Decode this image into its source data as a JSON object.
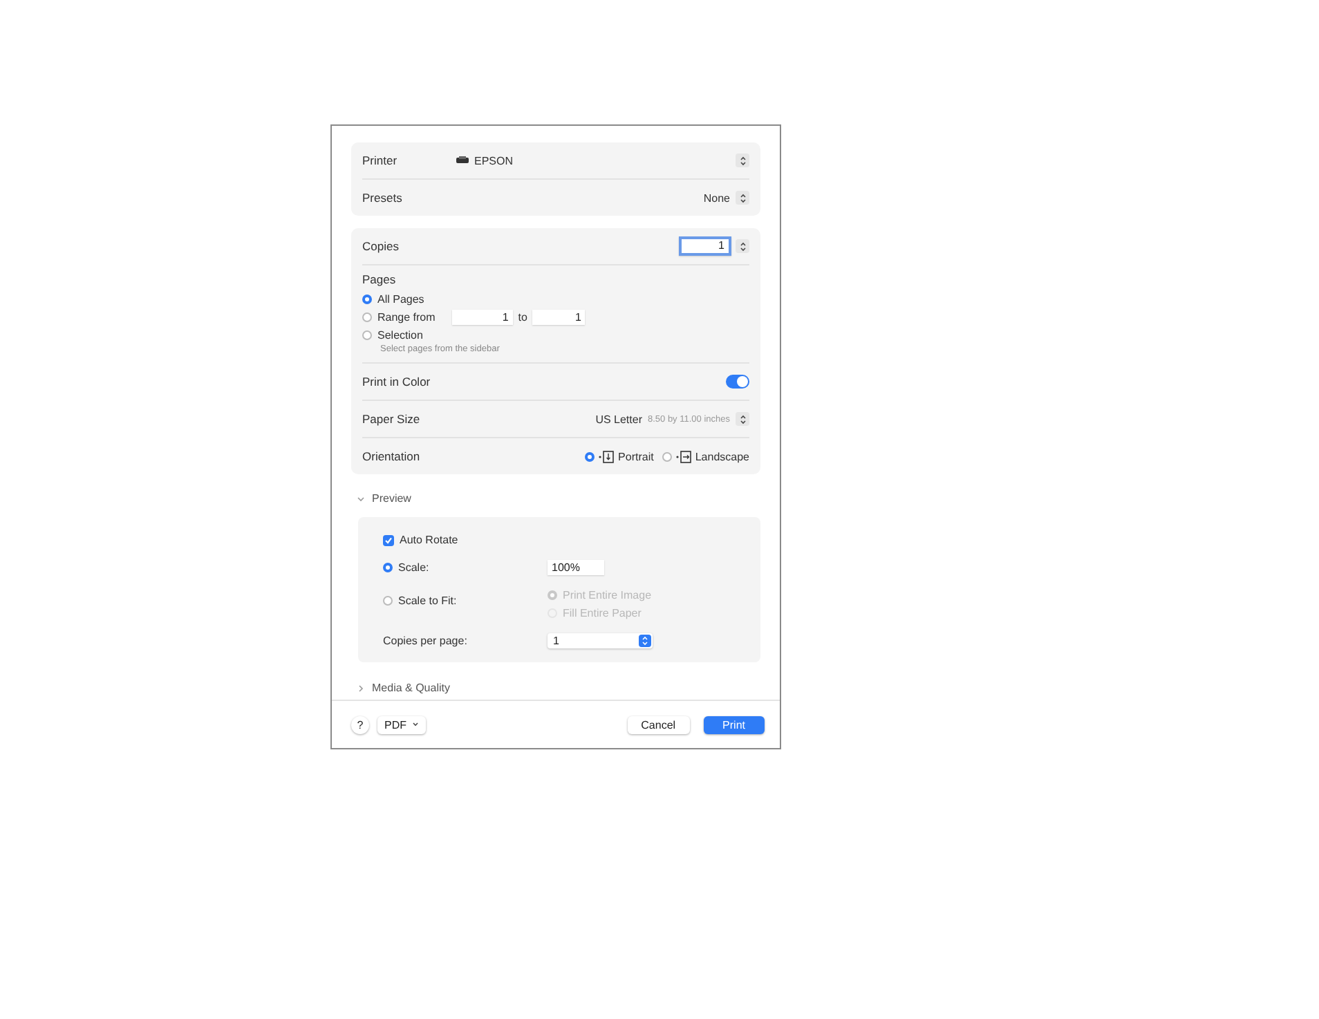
{
  "printer": {
    "label": "Printer",
    "value": "EPSON"
  },
  "presets": {
    "label": "Presets",
    "value": "None"
  },
  "copies": {
    "label": "Copies",
    "value": "1"
  },
  "pages": {
    "label": "Pages",
    "options": [
      {
        "kind": "all",
        "label": "All Pages",
        "selected": true
      },
      {
        "kind": "range",
        "label": "Range from",
        "selected": false,
        "from": "1",
        "to_label": "to",
        "to": "1"
      },
      {
        "kind": "selection",
        "label": "Selection",
        "selected": false,
        "hint": "Select pages from the sidebar"
      }
    ]
  },
  "print_in_color": {
    "label": "Print in Color",
    "on": true
  },
  "paper_size": {
    "label": "Paper Size",
    "value": "US Letter",
    "detail": "8.50 by 11.00 inches"
  },
  "orientation": {
    "label": "Orientation",
    "options": [
      {
        "kind": "portrait",
        "label": "Portrait",
        "selected": true
      },
      {
        "kind": "landscape",
        "label": "Landscape",
        "selected": false
      }
    ]
  },
  "preview": {
    "label": "Preview",
    "expanded": true,
    "auto_rotate": {
      "label": "Auto Rotate",
      "checked": true
    },
    "scale_options": [
      {
        "label": "Scale:",
        "selected": true,
        "value": "100%"
      },
      {
        "label": "Scale to Fit:",
        "selected": false
      }
    ],
    "fit_options": [
      {
        "label": "Print Entire Image",
        "selected": true,
        "disabled": true
      },
      {
        "label": "Fill Entire Paper",
        "selected": false,
        "disabled": true
      }
    ],
    "copies_per_page": {
      "label": "Copies per page:",
      "value": "1"
    }
  },
  "media_quality": {
    "label": "Media & Quality",
    "expanded": false
  },
  "footer": {
    "help": "?",
    "pdf": "PDF",
    "cancel": "Cancel",
    "print": "Print"
  }
}
